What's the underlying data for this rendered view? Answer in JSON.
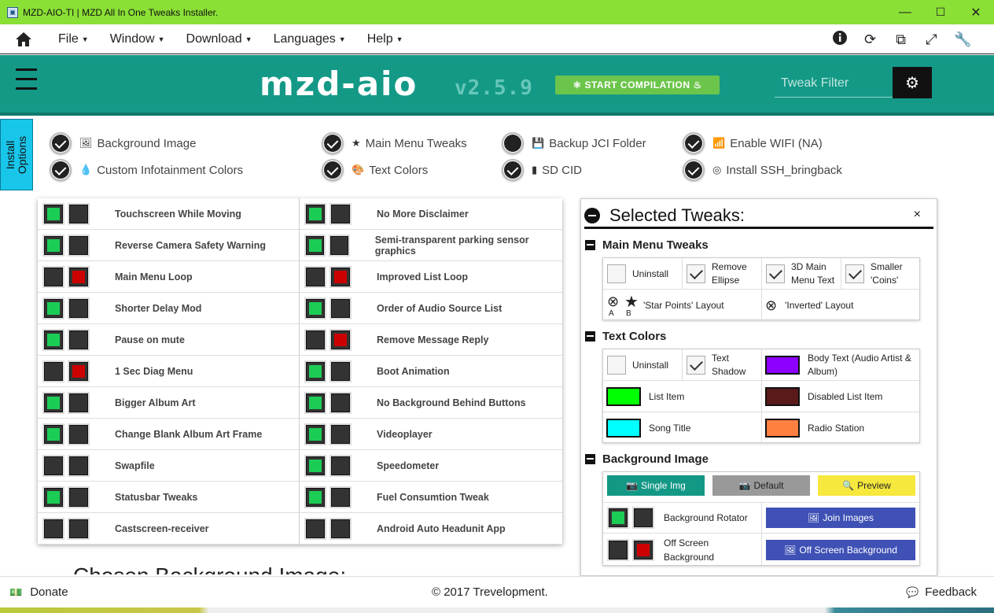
{
  "window": {
    "title": "MZD-AIO-TI | MZD All In One Tweaks Installer.",
    "minimize": "—",
    "maximize": "☐",
    "close": "✕"
  },
  "menubar": {
    "items": [
      "File",
      "Window",
      "Download",
      "Languages",
      "Help"
    ]
  },
  "header": {
    "logo": "mzd-aio",
    "version": "v2.5.9",
    "start_button": "⚛ START COMPILATION ♨",
    "filter_placeholder": "Tweak Filter"
  },
  "install_tab": "Install Options",
  "options": [
    {
      "label": "Background Image",
      "icon": "🖼",
      "checked": true
    },
    {
      "label": "Main Menu Tweaks",
      "icon": "★",
      "checked": true
    },
    {
      "label": "Backup JCI Folder",
      "icon": "💾",
      "checked": false
    },
    {
      "label": "Enable WIFI (NA)",
      "icon": "📶",
      "checked": true
    },
    {
      "label": "Custom Infotainment Colors",
      "icon": "💧",
      "checked": true
    },
    {
      "label": "Text Colors",
      "icon": "🎨",
      "checked": true
    },
    {
      "label": "SD CID",
      "icon": "▮",
      "checked": true
    },
    {
      "label": "Install SSH_bringback",
      "icon": "◎",
      "checked": true
    }
  ],
  "tweaks_left": [
    {
      "label": "Touchscreen While Moving",
      "a": "g",
      "b": ""
    },
    {
      "label": "Reverse Camera Safety Warning",
      "a": "g",
      "b": ""
    },
    {
      "label": "Main Menu Loop",
      "a": "",
      "b": "r"
    },
    {
      "label": "Shorter Delay Mod",
      "a": "g",
      "b": ""
    },
    {
      "label": "Pause on mute",
      "a": "g",
      "b": ""
    },
    {
      "label": "1 Sec Diag Menu",
      "a": "",
      "b": "r"
    },
    {
      "label": "Bigger Album Art",
      "a": "g",
      "b": ""
    },
    {
      "label": "Change Blank Album Art Frame",
      "a": "g",
      "b": ""
    },
    {
      "label": "Swapfile",
      "a": "",
      "b": ""
    },
    {
      "label": "Statusbar Tweaks",
      "a": "g",
      "b": ""
    },
    {
      "label": "Castscreen-receiver",
      "a": "",
      "b": ""
    }
  ],
  "tweaks_right": [
    {
      "label": "No More Disclaimer",
      "a": "g",
      "b": ""
    },
    {
      "label": "Semi-transparent parking sensor graphics",
      "a": "g",
      "b": ""
    },
    {
      "label": "Improved List Loop",
      "a": "",
      "b": "r"
    },
    {
      "label": "Order of Audio Source List",
      "a": "g",
      "b": ""
    },
    {
      "label": "Remove Message Reply",
      "a": "",
      "b": "r"
    },
    {
      "label": "Boot Animation",
      "a": "g",
      "b": ""
    },
    {
      "label": "No Background Behind Buttons",
      "a": "g",
      "b": ""
    },
    {
      "label": "Videoplayer",
      "a": "g",
      "b": ""
    },
    {
      "label": "Speedometer",
      "a": "g",
      "b": ""
    },
    {
      "label": "Fuel Consumtion Tweak",
      "a": "g",
      "b": ""
    },
    {
      "label": "Android Auto Headunit App",
      "a": "",
      "b": ""
    }
  ],
  "chosen_bg": "Chosen Background Image:",
  "panel": {
    "title": "Selected Tweaks:",
    "close": "×",
    "main_menu": {
      "title": "Main Menu Tweaks",
      "uninstall": "Uninstall",
      "remove_ellipse": "Remove Ellipse",
      "main_menu_text": "3D Main Menu Text",
      "smaller_coins": "Smaller 'Coins'",
      "star_layout": "'Star Points' Layout",
      "inverted_layout": "'Inverted' Layout",
      "label_a": "A",
      "label_b": "B"
    },
    "text_colors": {
      "title": "Text Colors",
      "uninstall": "Uninstall",
      "text_shadow": "Text Shadow",
      "body_text": "Body Text (Audio Artist & Album)",
      "body_color": "#8b00ff",
      "list_item": "List Item",
      "list_color": "#00ff00",
      "disabled_item": "Disabled List Item",
      "disabled_color": "#5a1a1a",
      "song_title": "Song Title",
      "song_color": "#00ffff",
      "radio_station": "Radio Station",
      "radio_color": "#ff8040"
    },
    "background": {
      "title": "Background Image",
      "single": "Single Img",
      "default": "Default",
      "preview": "Preview",
      "rotator": "Background Rotator",
      "join": "Join Images",
      "offscreen": "Off Screen Background",
      "offscreen_bg": "Off Screen Background"
    }
  },
  "footer": {
    "donate": "Donate",
    "copyright": "© 2017 Trevelopment.",
    "feedback": "Feedback"
  }
}
